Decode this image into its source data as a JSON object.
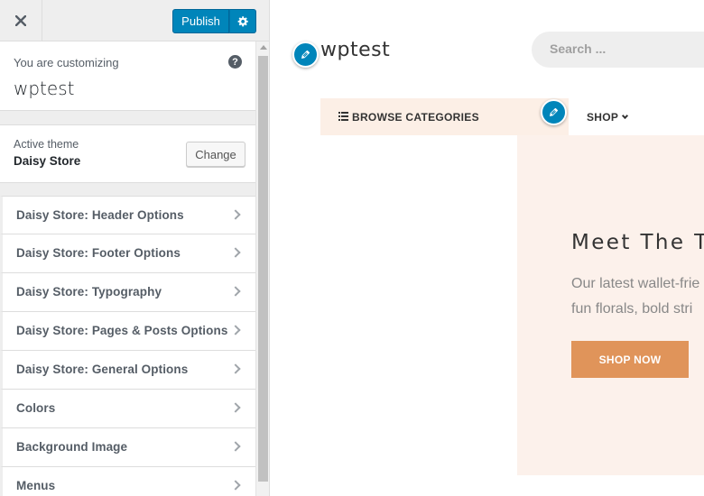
{
  "sidebar": {
    "close_icon": "close-icon",
    "publish_label": "Publish",
    "publish_settings_icon": "gear-icon",
    "customizing_label": "You are customizing",
    "site_title": "wptest",
    "help_icon": "?",
    "active_theme_label": "Active theme",
    "active_theme_name": "Daisy Store",
    "change_label": "Change",
    "panels": [
      {
        "label": "Daisy Store: Header Options"
      },
      {
        "label": "Daisy Store: Footer Options"
      },
      {
        "label": "Daisy Store: Typography"
      },
      {
        "label": "Daisy Store: Pages & Posts Options"
      },
      {
        "label": "Daisy Store: General Options"
      },
      {
        "label": "Colors"
      },
      {
        "label": "Background Image"
      },
      {
        "label": "Menus"
      }
    ]
  },
  "preview": {
    "site_title": "wptest",
    "search_placeholder": "Search ...",
    "browse_label": "BROWSE CATEGORIES",
    "shop_label": "SHOP",
    "hero_title": "Meet The T",
    "hero_line1": "Our latest wallet-frie",
    "hero_line2": "fun florals, bold stri",
    "shop_now_label": "SHOP NOW"
  },
  "colors": {
    "accent_blue": "#0085ba",
    "hero_bg": "#fcf1eb",
    "nav_bg": "#fcefe6",
    "button_orange": "#e0945a"
  }
}
